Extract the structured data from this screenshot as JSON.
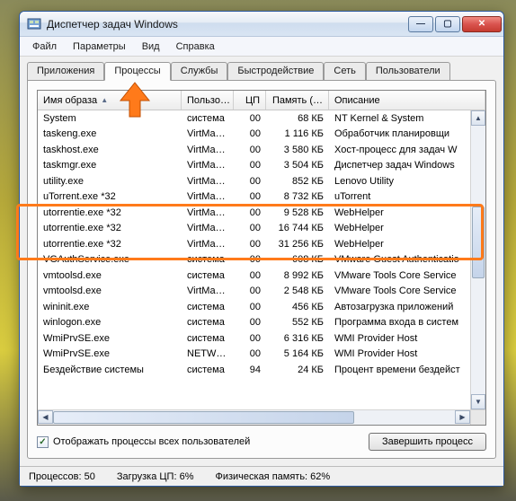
{
  "window": {
    "title": "Диспетчер задач Windows"
  },
  "menu": {
    "file": "Файл",
    "options": "Параметры",
    "view": "Вид",
    "help": "Справка"
  },
  "tabs": {
    "applications": "Приложения",
    "processes": "Процессы",
    "services": "Службы",
    "performance": "Быстродействие",
    "network": "Сеть",
    "users": "Пользователи"
  },
  "columns": {
    "image_name": "Имя образа",
    "user": "Пользо…",
    "cpu": "ЦП",
    "memory": "Память (…",
    "description": "Описание"
  },
  "rows": [
    {
      "name": "System",
      "user": "система",
      "cpu": "00",
      "mem": "68 КБ",
      "desc": "NT Kernel & System"
    },
    {
      "name": "taskeng.exe",
      "user": "VirtMac…",
      "cpu": "00",
      "mem": "1 116 КБ",
      "desc": "Обработчик планировщи"
    },
    {
      "name": "taskhost.exe",
      "user": "VirtMac…",
      "cpu": "00",
      "mem": "3 580 КБ",
      "desc": "Хост-процесс для задач W"
    },
    {
      "name": "taskmgr.exe",
      "user": "VirtMac…",
      "cpu": "00",
      "mem": "3 504 КБ",
      "desc": "Диспетчер задач Windows"
    },
    {
      "name": "utility.exe",
      "user": "VirtMac…",
      "cpu": "00",
      "mem": "852 КБ",
      "desc": "Lenovo Utility"
    },
    {
      "name": "uTorrent.exe *32",
      "user": "VirtMac…",
      "cpu": "00",
      "mem": "8 732 КБ",
      "desc": "uTorrent"
    },
    {
      "name": "utorrentie.exe *32",
      "user": "VirtMac…",
      "cpu": "00",
      "mem": "9 528 КБ",
      "desc": "WebHelper"
    },
    {
      "name": "utorrentie.exe *32",
      "user": "VirtMac…",
      "cpu": "00",
      "mem": "16 744 КБ",
      "desc": "WebHelper"
    },
    {
      "name": "utorrentie.exe *32",
      "user": "VirtMac…",
      "cpu": "00",
      "mem": "31 256 КБ",
      "desc": "WebHelper"
    },
    {
      "name": "VGAuthService.exe",
      "user": "система",
      "cpu": "00",
      "mem": "608 КБ",
      "desc": "VMware Guest Authenticatio"
    },
    {
      "name": "vmtoolsd.exe",
      "user": "система",
      "cpu": "00",
      "mem": "8 992 КБ",
      "desc": "VMware Tools Core Service"
    },
    {
      "name": "vmtoolsd.exe",
      "user": "VirtMac…",
      "cpu": "00",
      "mem": "2 548 КБ",
      "desc": "VMware Tools Core Service"
    },
    {
      "name": "wininit.exe",
      "user": "система",
      "cpu": "00",
      "mem": "456 КБ",
      "desc": "Автозагрузка приложений"
    },
    {
      "name": "winlogon.exe",
      "user": "система",
      "cpu": "00",
      "mem": "552 КБ",
      "desc": "Программа входа в систем"
    },
    {
      "name": "WmiPrvSE.exe",
      "user": "система",
      "cpu": "00",
      "mem": "6 316 КБ",
      "desc": "WMI Provider Host"
    },
    {
      "name": "WmiPrvSE.exe",
      "user": "NETWO…",
      "cpu": "00",
      "mem": "5 164 КБ",
      "desc": "WMI Provider Host"
    },
    {
      "name": "Бездействие системы",
      "user": "система",
      "cpu": "94",
      "mem": "24 КБ",
      "desc": "Процент времени бездейст"
    }
  ],
  "checkbox": {
    "show_all_users": "Отображать процессы всех пользователей",
    "checked": "✓"
  },
  "buttons": {
    "end_process": "Завершить процесс"
  },
  "status": {
    "processes": "Процессов: 50",
    "cpu": "Загрузка ЦП: 6%",
    "mem": "Физическая память: 62%"
  }
}
